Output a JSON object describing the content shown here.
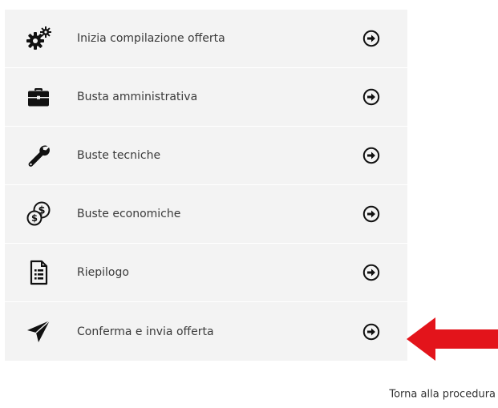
{
  "menu": {
    "items": [
      {
        "label": "Inizia compilazione offerta",
        "icon": "gears-icon"
      },
      {
        "label": "Busta amministrativa",
        "icon": "briefcase-icon"
      },
      {
        "label": "Buste tecniche",
        "icon": "wrench-icon"
      },
      {
        "label": "Buste economiche",
        "icon": "dollar-coins-icon"
      },
      {
        "label": "Riepilogo",
        "icon": "document-list-icon"
      },
      {
        "label": "Conferma e invia offerta",
        "icon": "paper-plane-icon"
      }
    ]
  },
  "footer": {
    "back_link": "Torna alla procedura"
  },
  "colors": {
    "menu_bg": "#f3f3f3",
    "icon": "#111111",
    "pointer_arrow": "#e3141b"
  }
}
